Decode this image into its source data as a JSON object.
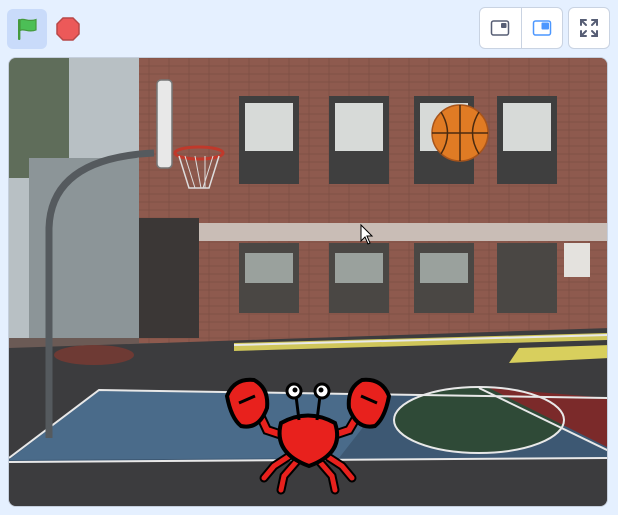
{
  "toolbar": {
    "green_flag_icon": "green-flag-icon",
    "stop_icon": "stop-sign-icon",
    "small_stage_icon": "small-stage-layout-icon",
    "normal_stage_icon": "normal-stage-layout-icon",
    "fullscreen_icon": "fullscreen-icon"
  },
  "colors": {
    "accent": "#4c97ff",
    "flag_green": "#4cbf56",
    "stop_red": "#ec5959",
    "toolbar_bg": "#e5f0ff"
  },
  "stage": {
    "backdrop": "basketball-court",
    "sprites": [
      "basketball",
      "crab"
    ]
  }
}
